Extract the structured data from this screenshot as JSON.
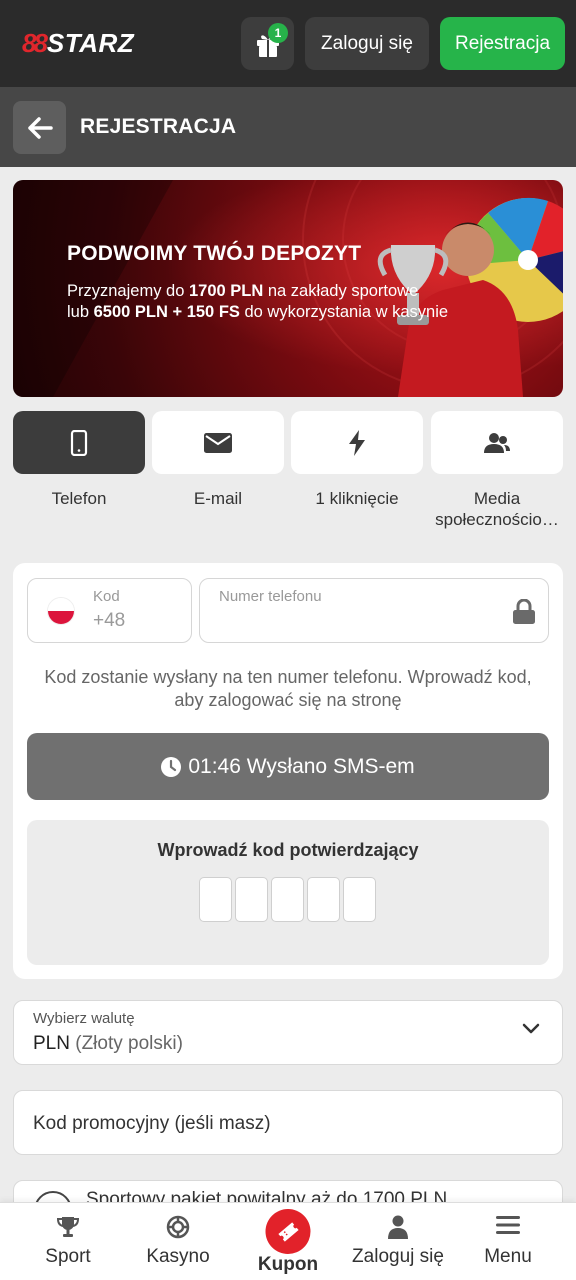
{
  "header": {
    "logo_mark": "88",
    "logo_text": "STARZ",
    "gift_badge": "1",
    "login_label": "Zaloguj się",
    "register_label": "Rejestracja"
  },
  "titlebar": {
    "title": "REJESTRACJA"
  },
  "banner": {
    "title": "PODWOIMY TWÓJ DEPOZYT",
    "line1_pre": "Przyznajemy do ",
    "line1_bold": "1700 PLN",
    "line1_post": " na zakłady sportowe",
    "line2_pre": "lub ",
    "line2_bold": "6500 PLN + 150 FS",
    "line2_post": " do wykorzystania w kasynie"
  },
  "methods": [
    {
      "label": "Telefon",
      "icon": "phone-icon",
      "active": true
    },
    {
      "label": "E-mail",
      "icon": "envelope-icon",
      "active": false
    },
    {
      "label": "1 kliknięcie",
      "icon": "lightning-icon",
      "active": false
    },
    {
      "label": "Media społecznościo…",
      "icon": "people-icon",
      "active": false
    }
  ],
  "phone_form": {
    "code_label": "Kod",
    "code_value": "+48",
    "phone_placeholder": "Numer telefonu",
    "hint": "Kod zostanie wysłany na ten numer telefonu. Wprowadź kod, aby zalogować się na stronę",
    "sms_timer": "01:46",
    "sms_label": "Wysłano SMS-em",
    "otp_title": "Wprowadź kod potwierdzający"
  },
  "currency": {
    "label": "Wybierz walutę",
    "code": "PLN",
    "name": "(Złoty polski)"
  },
  "promo": {
    "placeholder": "Kod promocyjny (jeśli masz)"
  },
  "bonus": {
    "text": "Sportowy pakiet powitalny aż do 1700 PLN"
  },
  "bottom_nav": [
    {
      "label": "Sport",
      "icon": "trophy-icon"
    },
    {
      "label": "Kasyno",
      "icon": "casino-chip-icon"
    },
    {
      "label": "Kupon",
      "icon": "ticket-icon"
    },
    {
      "label": "Zaloguj się",
      "icon": "user-icon"
    },
    {
      "label": "Menu",
      "icon": "menu-icon"
    }
  ],
  "colors": {
    "accent_green": "#26b44a",
    "brand_red": "#e0262c",
    "header_bg": "#2b2b2b"
  }
}
